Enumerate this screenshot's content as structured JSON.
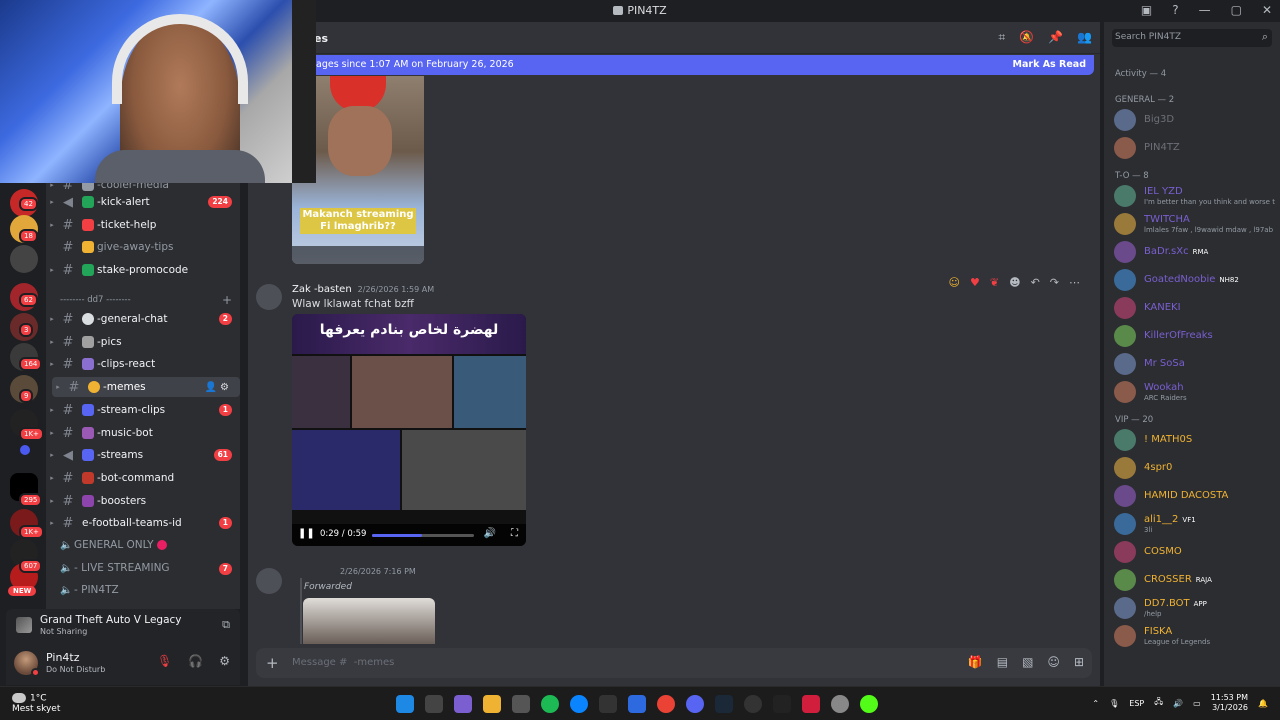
{
  "window": {
    "title": "PIN4TZ"
  },
  "channels": [
    {
      "name": "-cooler-media",
      "unread": false,
      "badge": "",
      "kind": "text",
      "emoji_color": "#949ba4"
    },
    {
      "name": "-kick-alert",
      "unread": true,
      "badge": "224",
      "kind": "announce",
      "emoji_color": "#23a559"
    },
    {
      "name": "-ticket-help",
      "unread": true,
      "badge": "",
      "kind": "text",
      "emoji_color": "#f23f43"
    },
    {
      "name": "give-away-tips",
      "unread": false,
      "badge": "",
      "kind": "text",
      "emoji_color": "#f0b232"
    },
    {
      "name": "stake-promocode",
      "unread": true,
      "badge": "",
      "kind": "text",
      "emoji_color": "#23a559"
    },
    {
      "name": "-general-chat",
      "unread": true,
      "badge": "2",
      "kind": "text",
      "emoji_color": "#dbdee1"
    },
    {
      "name": "-pics",
      "unread": true,
      "badge": "",
      "kind": "text",
      "emoji_color": "#a0a0a0"
    },
    {
      "name": "-clips-react",
      "unread": true,
      "badge": "",
      "kind": "text",
      "emoji_color": "#8a6fd1"
    },
    {
      "name": "-memes",
      "unread": true,
      "badge": "",
      "kind": "text",
      "emoji_color": "#f0b232",
      "active": true
    },
    {
      "name": "-stream-clips",
      "unread": true,
      "badge": "1",
      "kind": "text",
      "emoji_color": "#5865f2"
    },
    {
      "name": "-music-bot",
      "unread": true,
      "badge": "",
      "kind": "text",
      "emoji_color": "#9b59b6"
    },
    {
      "name": "-streams",
      "unread": true,
      "badge": "61",
      "kind": "announce",
      "emoji_color": "#5865f2"
    },
    {
      "name": "-bot-command",
      "unread": true,
      "badge": "",
      "kind": "text",
      "emoji_color": "#c0392b"
    },
    {
      "name": "-boosters",
      "unread": true,
      "badge": "",
      "kind": "text",
      "emoji_color": "#8e44ad"
    },
    {
      "name": "e-football-teams-id",
      "unread": true,
      "badge": "1",
      "kind": "text",
      "emoji_color": ""
    }
  ],
  "category": {
    "label": "-------- dd7 --------"
  },
  "voice_channels": [
    {
      "name": "GENERAL ONLY",
      "badge": ""
    },
    {
      "name": "- LIVE STREAMING",
      "badge": "7"
    },
    {
      "name": "- PIN4TZ",
      "badge": ""
    }
  ],
  "servers": {
    "badges": [
      "42",
      "18",
      "62",
      "3",
      "164",
      "9",
      "1K+",
      "295",
      "1K+",
      "607"
    ],
    "new_label": "NEW"
  },
  "activity": {
    "game": "Grand Theft Auto V Legacy",
    "status": "Not Sharing"
  },
  "user": {
    "name": "Pin4tz",
    "status": "Do Not Disturb"
  },
  "chat": {
    "channel_title": "es",
    "new_messages": "ages since 1:07 AM on February 26, 2026",
    "mark_read": "Mark As Read",
    "video1_caption": "Makanch streaming Fi lmaghrib??",
    "message": {
      "author": "Zak -basten",
      "time": "2/26/2026 1:59 AM",
      "text": "Wlaw lklawat fchat bzff",
      "video_title": "لهضرة لخاص بنادم يعرفها",
      "video_time": "0:29 / 0:59",
      "progress": 0.49
    },
    "forwarded": {
      "time": "2/26/2026 7:16 PM",
      "label": "Forwarded"
    },
    "composer_placeholder": "Message #  -memes"
  },
  "members": {
    "search_placeholder": "Search PIN4TZ",
    "activity_header": "Activity — 4",
    "groups": [
      {
        "header": "GENERAL — 2",
        "members": [
          {
            "name": "Big3D",
            "color": "#6d6f78",
            "sub": "",
            "tag": ""
          },
          {
            "name": "PIN4TZ",
            "color": "#6d6f78",
            "sub": "",
            "tag": ""
          }
        ]
      },
      {
        "header": "T-O — 8",
        "members": [
          {
            "name": "IEL YZD",
            "color": "#7b5fd1",
            "sub": "I'm better than you think and worse t",
            "tag": ""
          },
          {
            "name": "TWITCHA",
            "color": "#7b5fd1",
            "sub": "lmlales 7faw , l9wawid mdaw , l97ab",
            "tag": ""
          },
          {
            "name": "BaDr.sXc",
            "color": "#7b5fd1",
            "sub": "",
            "tag": "RMA"
          },
          {
            "name": "GoatedNoobie",
            "color": "#7b5fd1",
            "sub": "",
            "tag": "NH82"
          },
          {
            "name": "KANEKI",
            "color": "#7b5fd1",
            "sub": "",
            "tag": ""
          },
          {
            "name": "KillerOfFreaks",
            "color": "#7b5fd1",
            "sub": "",
            "tag": ""
          },
          {
            "name": "Mr SoSa",
            "color": "#7b5fd1",
            "sub": "",
            "tag": ""
          },
          {
            "name": "Wookah",
            "color": "#7b5fd1",
            "sub": "ARC Raiders",
            "tag": ""
          }
        ]
      },
      {
        "header": "VIP — 20",
        "members": [
          {
            "name": "! MATH0S",
            "color": "#f0b232",
            "sub": "",
            "tag": ""
          },
          {
            "name": "4spr0",
            "color": "#f0b232",
            "sub": "",
            "tag": ""
          },
          {
            "name": "HAMID DACOSTA",
            "color": "#f0b232",
            "sub": "",
            "tag": ""
          },
          {
            "name": "ali1__2",
            "color": "#f0b232",
            "sub": "3li",
            "tag": "VF1"
          },
          {
            "name": "COSMO",
            "color": "#f0b232",
            "sub": "",
            "tag": ""
          },
          {
            "name": "CROSSER",
            "color": "#f0b232",
            "sub": "",
            "tag": "RAJA"
          },
          {
            "name": "DD7.BOT",
            "color": "#f0b232",
            "sub": "/help",
            "tag": "APP"
          },
          {
            "name": "FISKA",
            "color": "#f0b232",
            "sub": "League of Legends",
            "tag": ""
          }
        ]
      }
    ]
  },
  "taskbar": {
    "temp": "1°C",
    "weather": "Mest skyet",
    "lang": "ESP",
    "time": "11:53 PM",
    "date": "3/1/2026"
  },
  "icons": [
    "search-icon",
    "gear-icon",
    "threads-icon",
    "pin-icon",
    "members-icon",
    "gift-icon",
    "gif-icon",
    "sticker-icon",
    "emoji-icon",
    "play-icon",
    "volume-icon",
    "fullscreen-icon",
    "plus-icon",
    "microphone-muted-icon",
    "headphones-muted-icon",
    "screen-share-icon"
  ]
}
